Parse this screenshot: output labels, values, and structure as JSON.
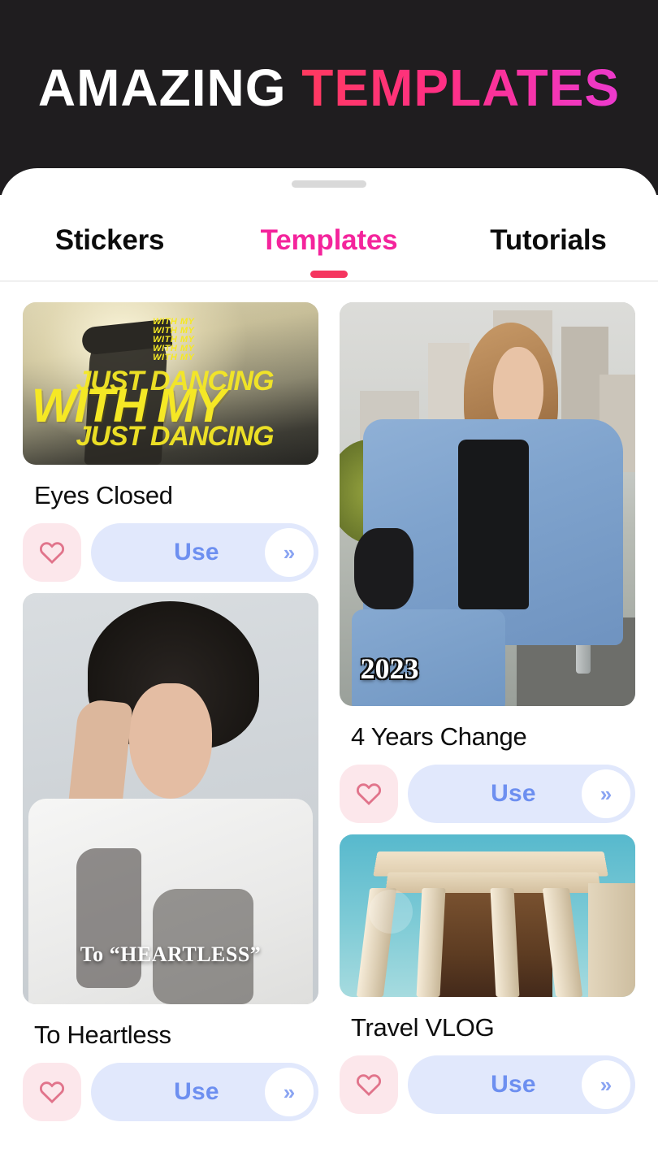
{
  "promo": {
    "title_part1": "AMAZING",
    "title_part2": "TEMPLATES",
    "bg_color": "#1f1d1f",
    "accent_gradient_from": "#ff3a5e",
    "accent_gradient_to": "#ec3ad0"
  },
  "sheet": {
    "drag_handle": "drag-handle"
  },
  "tabs": [
    {
      "label": "Stickers",
      "active": false
    },
    {
      "label": "Templates",
      "active": true
    },
    {
      "label": "Tutorials",
      "active": false
    }
  ],
  "colors": {
    "active_tab": "#f4249c",
    "tab_underline": "#f5355f",
    "use_button_bg": "#e1e8fc",
    "use_button_text": "#6d8ff0",
    "favorite_button_bg": "#fce7eb",
    "favorite_heart_outline": "#e1748b",
    "card_title": "#0d0d0d"
  },
  "actions": {
    "use_label": "Use",
    "chevron_glyph": "»",
    "heart_icon": "heart-outline-icon"
  },
  "templates": [
    {
      "id": "eyes-closed",
      "title": "Eyes Closed",
      "column": "left",
      "thumb_kind": "dancing",
      "overlay_texts": {
        "small_repeat": "WITH MY",
        "line_top": "JUST DANCING",
        "line_big": "WITH MY",
        "line_bottom": "JUST DANCING"
      },
      "use_label": "Use",
      "favorited": false
    },
    {
      "id": "4-years-change",
      "title": "4 Years Change",
      "column": "right",
      "thumb_kind": "denim",
      "overlay_texts": {
        "year": "2023"
      },
      "use_label": "Use",
      "favorited": false
    },
    {
      "id": "to-heartless",
      "title": "To Heartless",
      "column": "left",
      "thumb_kind": "guy",
      "overlay_texts": {
        "caption": "To “HEARTLESS”"
      },
      "use_label": "Use",
      "favorited": false
    },
    {
      "id": "travel-vlog",
      "title": "Travel VLOG",
      "column": "right",
      "thumb_kind": "travel",
      "overlay_texts": {},
      "use_label": "Use",
      "favorited": false
    }
  ]
}
